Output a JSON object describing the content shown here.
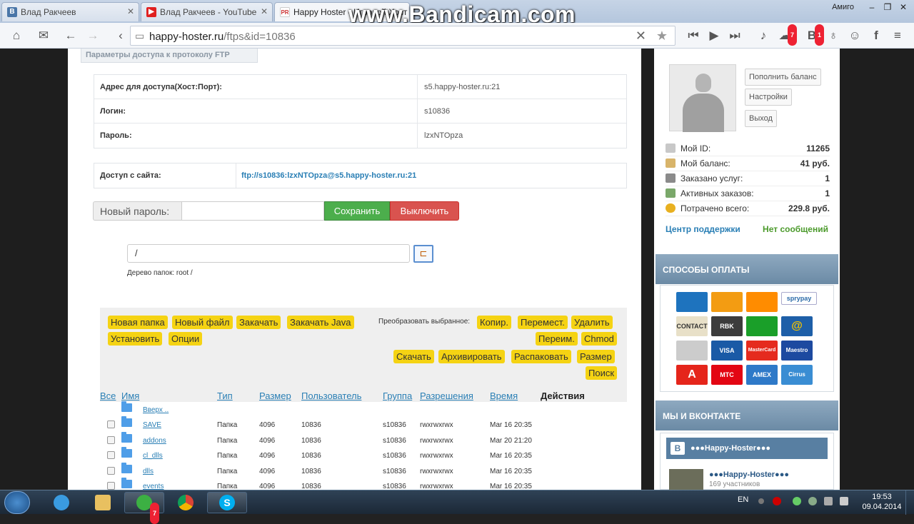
{
  "browser": {
    "tabs": [
      {
        "title": "Влад Ракчеев",
        "icon": "vk-icon"
      },
      {
        "title": "Влад Ракчеев - YouTube",
        "icon": "youtube-icon"
      },
      {
        "title": "Happy Hoster - Игровой Хост",
        "icon": "happy-hoster-icon"
      }
    ],
    "profile": "Амиго",
    "url_host": "happy-hoster.ru",
    "url_path": "/ftps&id=10836",
    "badges": {
      "chat": "7",
      "vk": "1"
    }
  },
  "watermark": "www.Bandicam.com",
  "ftp": {
    "section_title": "Параметры доступа к протоколу FTP",
    "rows": [
      {
        "label": "Адрес для доступа(Хост:Порт):",
        "value": "s5.happy-hoster.ru:21"
      },
      {
        "label": "Логин:",
        "value": "s10836"
      },
      {
        "label": "Пароль:",
        "value": "lzxNTOpza"
      }
    ],
    "site_access_label": "Доступ с сайта:",
    "site_access_value": "ftp://s10836:lzxNTOpza@s5.happy-hoster.ru:21",
    "new_password_label": "Новый пароль:",
    "new_password_value": "",
    "save_label": "Сохранить",
    "disable_label": "Выключить"
  },
  "filemanager": {
    "path": "/",
    "tree_label": "Дерево папок: root /",
    "buttons": {
      "new_folder": "Новая папка",
      "new_file": "Новый файл",
      "upload": "Закачать",
      "upload_java": "Закачать Java",
      "install": "Установить",
      "options": "Опции",
      "convert_label": "Преобразовать выбранное:",
      "copy": "Копир.",
      "move": "Перемест.",
      "delete": "Удалить",
      "rename": "Переим.",
      "chmod": "Chmod",
      "download": "Скачать",
      "archive": "Архивировать",
      "extract": "Распаковать",
      "size": "Размер",
      "search": "Поиск"
    },
    "columns": {
      "all": "Все",
      "name": "Имя",
      "type": "Тип",
      "size": "Размер",
      "user": "Пользователь",
      "group": "Группа",
      "perms": "Разрешения",
      "time": "Время",
      "actions": "Действия"
    },
    "up_label": "Вверх ..",
    "rows": [
      {
        "name": "SAVE",
        "type": "Папка",
        "size": "4096",
        "user": "10836",
        "group": "s10836",
        "perms": "rwxrwxrwx",
        "time": "Mar 16 20:35"
      },
      {
        "name": "addons",
        "type": "Папка",
        "size": "4096",
        "user": "10836",
        "group": "s10836",
        "perms": "rwxrwxrwx",
        "time": "Mar 20 21:20"
      },
      {
        "name": "cl_dlls",
        "type": "Папка",
        "size": "4096",
        "user": "10836",
        "group": "s10836",
        "perms": "rwxrwxrwx",
        "time": "Mar 16 20:35"
      },
      {
        "name": "dlls",
        "type": "Папка",
        "size": "4096",
        "user": "10836",
        "group": "s10836",
        "perms": "rwxrwxrwx",
        "time": "Mar 16 20:35"
      },
      {
        "name": "events",
        "type": "Папка",
        "size": "4096",
        "user": "10836",
        "group": "s10836",
        "perms": "rwxrwxrwx",
        "time": "Mar 16 20:35"
      }
    ]
  },
  "sidebar": {
    "buttons": {
      "topup": "Пополнить баланс",
      "settings": "Настройки",
      "logout": "Выход"
    },
    "stats": [
      {
        "label": "Мой ID:",
        "value": "11265"
      },
      {
        "label": "Мой баланс:",
        "value": "41 руб."
      },
      {
        "label": "Заказано услуг:",
        "value": "1"
      },
      {
        "label": "Активных заказов:",
        "value": "1"
      },
      {
        "label": "Потрачено всего:",
        "value": "229.8 руб."
      }
    ],
    "support": "Центр поддержки",
    "no_messages": "Нет сообщений",
    "payment_title": "Способы оплаты",
    "payment_methods": [
      {
        "name": "webmoney",
        "label": "",
        "color": "#1e73be"
      },
      {
        "name": "yandex-money",
        "label": "",
        "color": "#f39c12"
      },
      {
        "name": "qiwi",
        "label": "",
        "color": "#ff8c00"
      },
      {
        "name": "sprypay",
        "label": "sprypay",
        "color": "#ffffff"
      },
      {
        "name": "contact",
        "label": "CONTACT",
        "color": "#e8e0c8"
      },
      {
        "name": "rbk",
        "label": "RBK",
        "color": "#3c3c3c"
      },
      {
        "name": "sberbank",
        "label": "",
        "color": "#1a9f29"
      },
      {
        "name": "email-pay",
        "label": "@",
        "color": "#1e5fa8"
      },
      {
        "name": "mail-pay",
        "label": "",
        "color": "#cccccc"
      },
      {
        "name": "visa",
        "label": "VISA",
        "color": "#1a5aa6"
      },
      {
        "name": "mastercard",
        "label": "MasterCard",
        "color": "#e52b1e"
      },
      {
        "name": "maestro",
        "label": "Maestro",
        "color": "#1d4aa0"
      },
      {
        "name": "alfa-bank",
        "label": "A",
        "color": "#e5251b"
      },
      {
        "name": "mts",
        "label": "МТС",
        "color": "#e30613"
      },
      {
        "name": "amex",
        "label": "AMEX",
        "color": "#2e79c8"
      },
      {
        "name": "cirrus",
        "label": "Cirrus",
        "color": "#3a8dd3"
      }
    ],
    "vk_title": "Мы и ВКонтакте",
    "vk_group": "●●●Happy-Hoster●●●",
    "vk_members": "169 участников"
  },
  "taskbar": {
    "lang": "EN",
    "time": "19:53",
    "date": "09.04.2014",
    "badge": "7"
  }
}
